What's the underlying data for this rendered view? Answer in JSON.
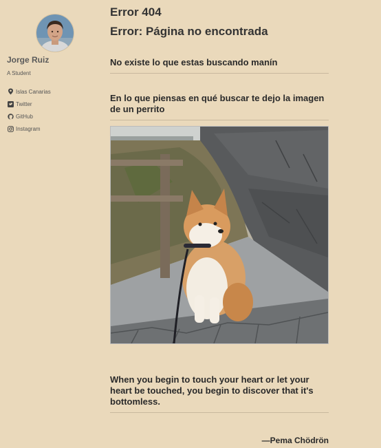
{
  "sidebar": {
    "author_name": "Jorge Ruiz",
    "author_bio": "A Student",
    "links": [
      {
        "icon": "map-marker-icon",
        "label": "Islas Canarias"
      },
      {
        "icon": "twitter-icon",
        "label": "Twitter"
      },
      {
        "icon": "github-icon",
        "label": "GitHub"
      },
      {
        "icon": "instagram-icon",
        "label": "Instagram"
      }
    ]
  },
  "main": {
    "title": "Error 404",
    "subtitle": "Error: Página no encontrada",
    "message": "No existe lo que estas buscando manín",
    "image_caption": "En lo que piensas en qué buscar te dejo la imagen de un perrito",
    "quote": "When you begin to touch your heart or let your heart be touched, you begin to discover that it's bottomless.",
    "quote_author": "—Pema Chödrön"
  },
  "colors": {
    "background": "#ead9bb",
    "heading": "#2a2a2a",
    "rule": "#c8b89e"
  }
}
